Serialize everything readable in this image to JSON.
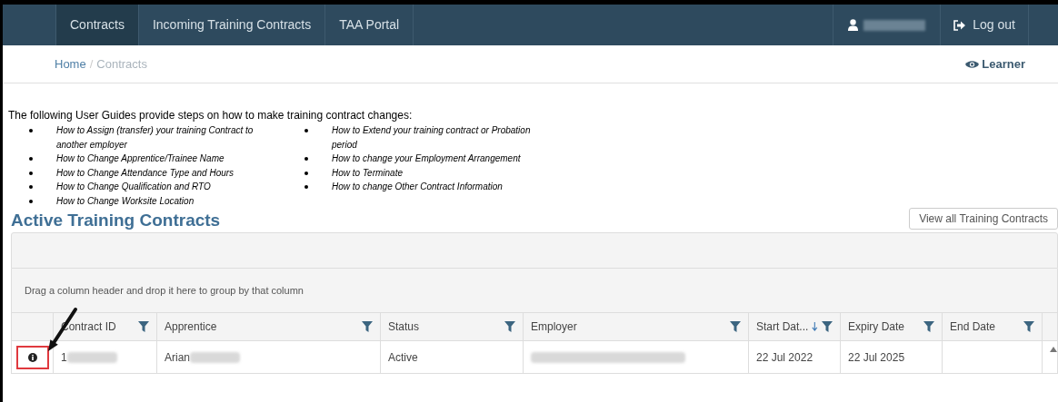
{
  "nav": {
    "tabs": [
      {
        "label": "Contracts",
        "selected": true
      },
      {
        "label": "Incoming Training Contracts",
        "selected": false
      },
      {
        "label": "TAA Portal",
        "selected": false
      }
    ],
    "logout": "Log out"
  },
  "breadcrumb": {
    "items": [
      "Home",
      "Contracts"
    ],
    "separator": "/",
    "role": "Learner"
  },
  "guides": {
    "intro": "The following User Guides provide steps on how to make training contract changes:",
    "columns": [
      [
        "How to Assign (transfer) your training Contract to another employer",
        "How to Change Apprentice/Trainee Name",
        "How to Change Attendance Type and Hours",
        "How to Change Qualification and RTO",
        "How to Change Worksite Location"
      ],
      [
        "How to Extend your training contract or Probation period",
        "How to change your Employment Arrangement",
        "How to Terminate",
        "How to change Other Contract Information"
      ]
    ]
  },
  "section": {
    "title": "Active Training Contracts",
    "button": "View all Training Contracts"
  },
  "grid": {
    "group_hint": "Drag a column header and drop it here to group by that column",
    "columns": [
      {
        "label": "Contract ID",
        "sorted": false
      },
      {
        "label": "Apprentice",
        "sorted": false
      },
      {
        "label": "Status",
        "sorted": false
      },
      {
        "label": "Employer",
        "sorted": false
      },
      {
        "label": "Start Dat...",
        "sorted": true
      },
      {
        "label": "Expiry Date",
        "sorted": false
      },
      {
        "label": "End Date",
        "sorted": false
      }
    ],
    "rows": [
      {
        "cells": [
          "1",
          "Arian",
          "Active",
          "",
          "22 Jul 2022",
          "22 Jul 2025",
          ""
        ],
        "redacted": [
          true,
          true,
          false,
          true,
          false,
          false,
          false
        ]
      }
    ]
  }
}
